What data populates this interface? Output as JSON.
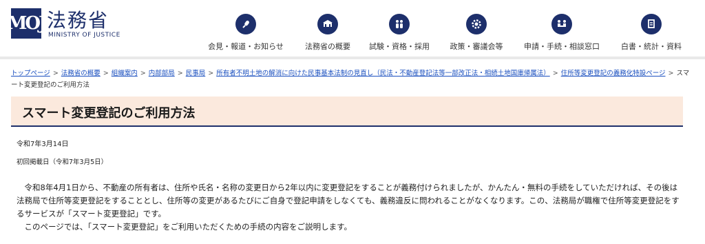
{
  "header": {
    "logo_mark": "MOJ",
    "logo_title": "法務省",
    "logo_subtitle": "MINISTRY OF JUSTICE",
    "nav": [
      {
        "label": "会見・報道・お知らせ",
        "icon": "microphone-icon"
      },
      {
        "label": "法務省の概要",
        "icon": "building-icon"
      },
      {
        "label": "試験・資格・採用",
        "icon": "people-icon"
      },
      {
        "label": "政策・審議会等",
        "icon": "gear-icon"
      },
      {
        "label": "申請・手続・相談窓口",
        "icon": "consultation-icon"
      },
      {
        "label": "白書・統計・資料",
        "icon": "document-icon"
      }
    ]
  },
  "breadcrumb": {
    "items": [
      "トップページ",
      "法務省の概要",
      "組織案内",
      "内部部局",
      "民事局",
      "所有者不明土地の解消に向けた民事基本法制の見直し（民法・不動産登記法等一部改正法・相続土地国庫帰属法）",
      "住所等変更登記の義務化特設ページ"
    ],
    "current": "スマート変更登記のご利用方法"
  },
  "page": {
    "title": "スマート変更登記のご利用方法",
    "date": "令和7年3月14日",
    "first_posted": "初回掲載日（令和7年3月5日）",
    "paragraph1": "令和8年4月1日から、不動産の所有者は、住所や氏名・名称の変更日から2年以内に変更登記をすることが義務付けられましたが、かんたん・無料の手続をしていただければ、その後は法務局で住所等変更登記をすることとし、住所等の変更があるたびにご自身で登記申請をしなくても、義務違反に問われることがなくなります。この、法務局が職権で住所等変更登記をするサービスが「スマート変更登記」です。",
    "paragraph2": "このページでは、「スマート変更登記」をご利用いただくための手続の内容をご説明します。"
  },
  "colors": {
    "brand": "#1d2f6b",
    "title_bg": "#fbe9dd",
    "link": "#1a4fbf"
  }
}
